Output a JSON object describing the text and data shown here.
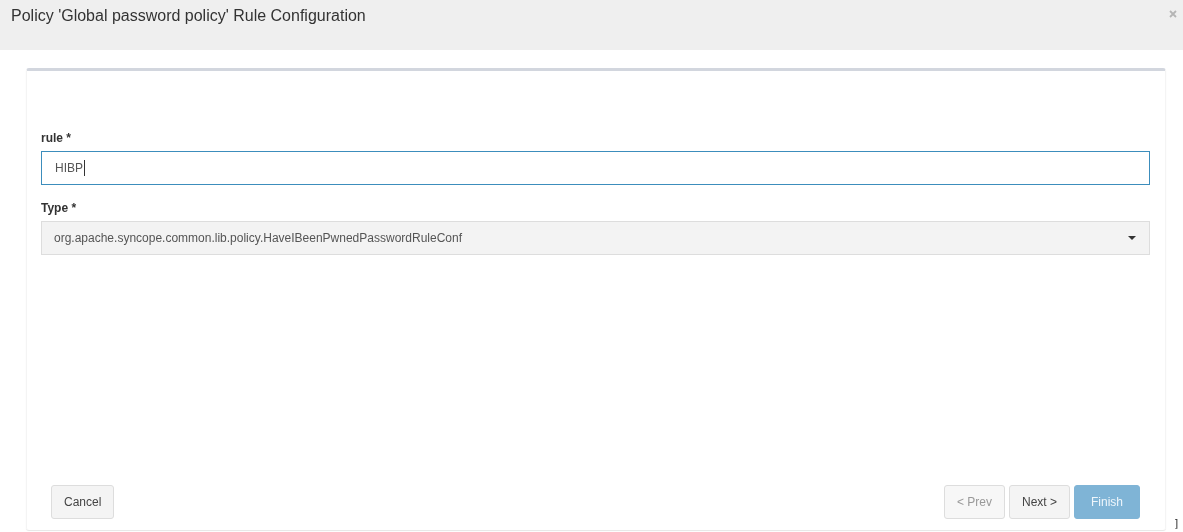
{
  "dialog": {
    "title": "Policy 'Global password policy' Rule Configuration"
  },
  "fields": [
    {
      "kind": "text",
      "label": "rule *",
      "value": "HIBP",
      "focused": true
    },
    {
      "kind": "select",
      "label": "Type *",
      "value": "org.apache.syncope.common.lib.policy.HaveIBeenPwnedPasswordRuleConf"
    }
  ],
  "buttons_left": [
    {
      "label": "Cancel",
      "disabled": false
    }
  ],
  "buttons_right": [
    {
      "label": "< Prev",
      "kind": "default",
      "disabled": true
    },
    {
      "label": "Next >",
      "kind": "default",
      "disabled": false
    },
    {
      "label": "Finish",
      "kind": "primary",
      "disabled": false
    }
  ],
  "edge_mark": "]"
}
